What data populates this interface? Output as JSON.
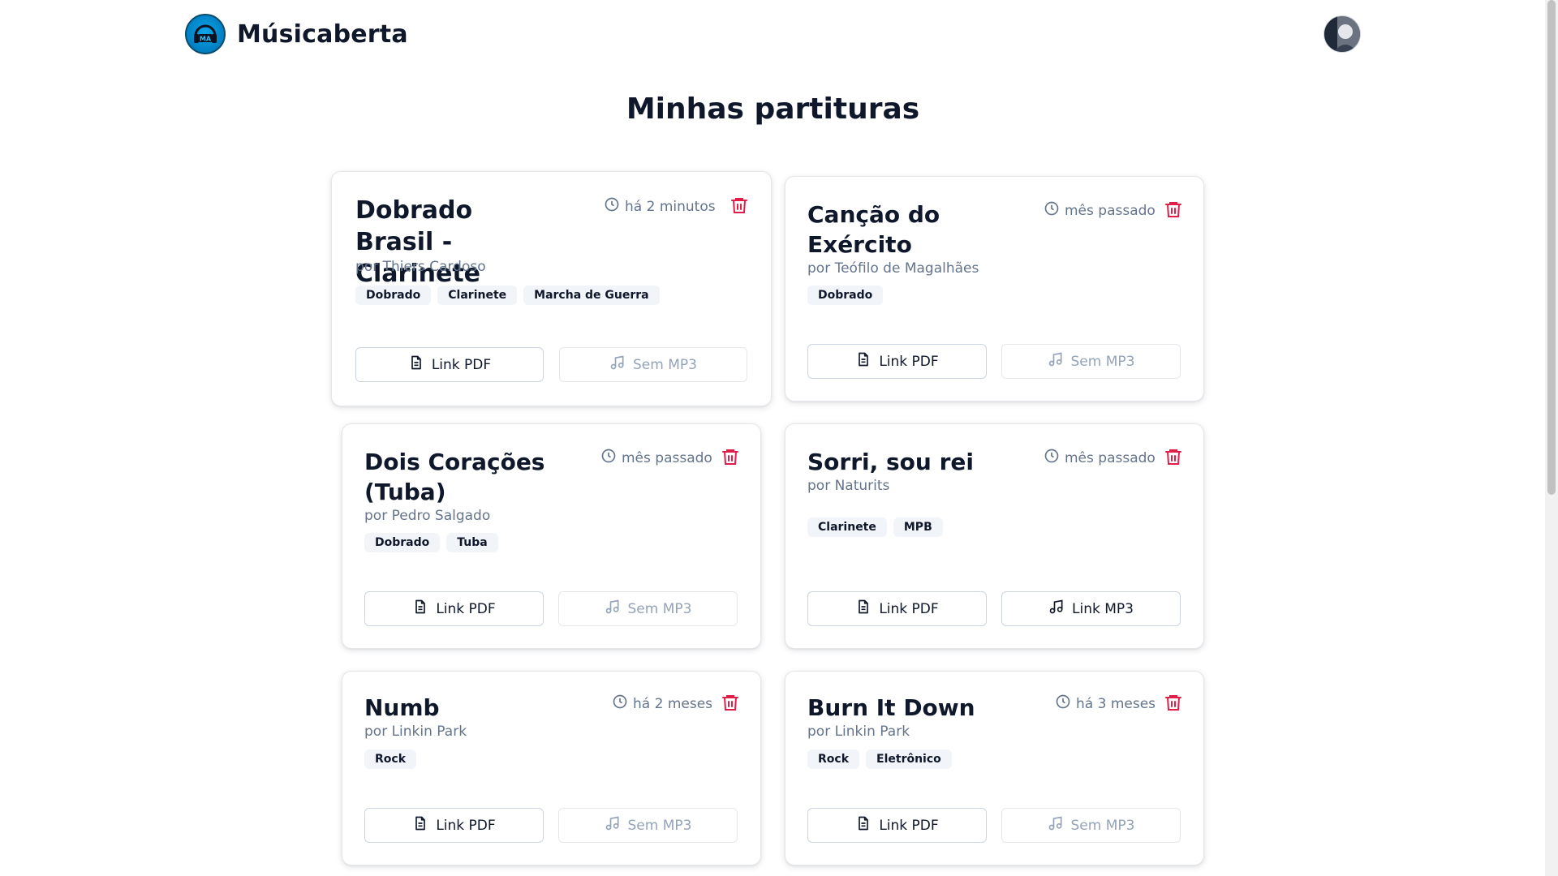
{
  "app": {
    "name": "Músicaberta",
    "logo_icon": "headphones-logo-icon",
    "avatar_icon": "user-avatar-icon"
  },
  "page": {
    "title": "Minhas partituras"
  },
  "colors": {
    "danger": "#e11d48",
    "muted": "#64748b",
    "tag_bg": "#f1f5f9",
    "brand": "#0284c7"
  },
  "cards": [
    {
      "title": "Dobrado Brasil - Clarinete",
      "author": "por Thiers Cardoso",
      "time": "há 2 minutos",
      "tags": [
        "Dobrado",
        "Clarinete",
        "Marcha de Guerra"
      ],
      "pdf_label": "Link PDF",
      "mp3_label": "Sem MP3",
      "mp3_available": false
    },
    {
      "title": "Canção do Exército",
      "author": "por Teófilo de Magalhães",
      "time": "mês passado",
      "tags": [
        "Dobrado"
      ],
      "pdf_label": "Link PDF",
      "mp3_label": "Sem MP3",
      "mp3_available": false
    },
    {
      "title": "Dois Corações (Tuba)",
      "author": "por Pedro Salgado",
      "time": "mês passado",
      "tags": [
        "Dobrado",
        "Tuba"
      ],
      "pdf_label": "Link PDF",
      "mp3_label": "Sem MP3",
      "mp3_available": false
    },
    {
      "title": "Sorri, sou rei",
      "author": "por Naturits",
      "time": "mês passado",
      "tags": [
        "Clarinete",
        "MPB"
      ],
      "pdf_label": "Link PDF",
      "mp3_label": "Link MP3",
      "mp3_available": true
    },
    {
      "title": "Numb",
      "author": "por Linkin Park",
      "time": "há 2 meses",
      "tags": [
        "Rock"
      ],
      "pdf_label": "Link PDF",
      "mp3_label": "Sem MP3",
      "mp3_available": false
    },
    {
      "title": "Burn It Down",
      "author": "por Linkin Park",
      "time": "há 3 meses",
      "tags": [
        "Rock",
        "Eletrônico"
      ],
      "pdf_label": "Link PDF",
      "mp3_label": "Sem MP3",
      "mp3_available": false
    }
  ]
}
